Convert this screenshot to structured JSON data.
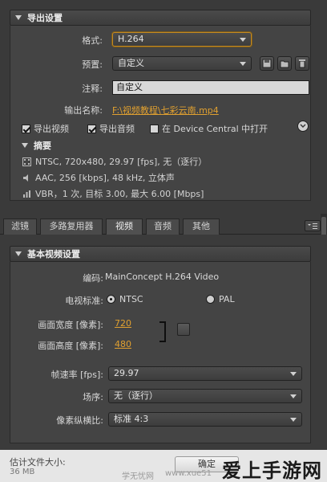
{
  "export_settings": {
    "header": "导出设置",
    "format_label": "格式:",
    "format_value": "H.264",
    "preset_label": "预置:",
    "preset_value": "自定义",
    "comment_label": "注释:",
    "comment_value": "自定义",
    "output_name_label": "输出名称:",
    "output_name_value": "F:\\视频教程\\七彩云南.mp4",
    "export_video_label": "导出视频",
    "export_video_checked": true,
    "export_audio_label": "导出音频",
    "export_audio_checked": true,
    "device_central_label": "在 Device Central 中打开",
    "device_central_checked": false
  },
  "summary": {
    "title": "摘要",
    "lines": [
      "NTSC, 720x480, 29.97 [fps], 无（逐行）",
      "AAC, 256 [kbps], 48 kHz, 立体声",
      "VBR，1 次, 目标 3.00, 最大 6.00 [Mbps]"
    ]
  },
  "tabs": {
    "items": [
      "滤镜",
      "多路复用器",
      "视频",
      "音频",
      "其他"
    ],
    "active": "视频"
  },
  "basic_video": {
    "header": "基本视频设置",
    "codec_label": "编码:",
    "codec_value": "MainConcept H.264 Video",
    "tv_standard_label": "电视标准:",
    "ntsc_label": "NTSC",
    "pal_label": "PAL",
    "selected_standard": "NTSC",
    "width_label": "画面宽度 [像素]:",
    "width_value": "720",
    "height_label": "画面高度 [像素]:",
    "height_value": "480",
    "framerate_label": "帧速率 [fps]:",
    "framerate_value": "29.97",
    "field_order_label": "场序:",
    "field_order_value": "无（逐行）",
    "pixel_aspect_label": "像素纵横比:",
    "pixel_aspect_value": "标准 4:3"
  },
  "footer": {
    "est_size_label": "估计文件大小:",
    "est_size_value": "36 MB",
    "ok_label": "确定",
    "watermark_site": "学无忧网",
    "watermark_url": "www.xue51",
    "watermark_brand": "爱上手游网"
  },
  "colors": {
    "link": "#e0a030",
    "focus_border": "#c48a22",
    "panel": "#444444"
  }
}
